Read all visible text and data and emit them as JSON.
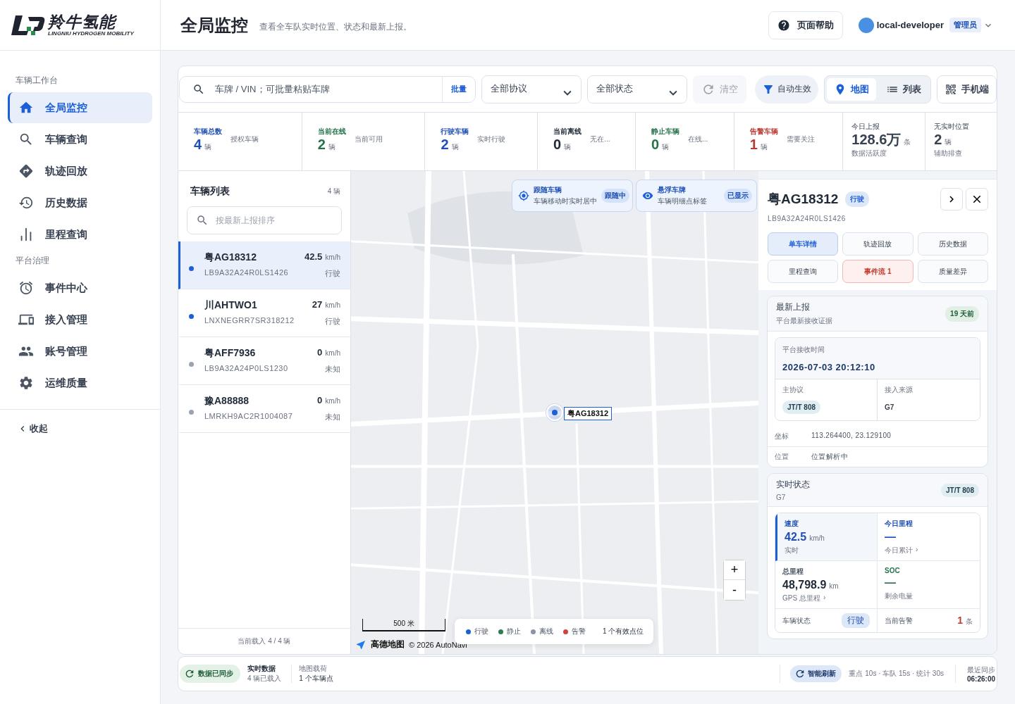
{
  "sidebar": {
    "logo": {
      "name": "羚牛氢能",
      "tagline": "LINGNIU HYDROGEN MOBILITY"
    },
    "sections": [
      {
        "title": "车辆工作台",
        "items": [
          {
            "label": "全局监控",
            "selected": true
          },
          {
            "label": "车辆查询",
            "selected": false
          },
          {
            "label": "轨迹回放",
            "selected": false
          },
          {
            "label": "历史数据",
            "selected": false
          },
          {
            "label": "里程查询",
            "selected": false
          }
        ]
      },
      {
        "title": "平台治理",
        "items": [
          {
            "label": "事件中心",
            "selected": false
          },
          {
            "label": "接入管理",
            "selected": false
          },
          {
            "label": "账号管理",
            "selected": false
          },
          {
            "label": "运维质量",
            "selected": false
          }
        ]
      }
    ],
    "collapse": "收起"
  },
  "header": {
    "title": "全局监控",
    "subtitle": "查看全车队实时位置、状态和最新上报。",
    "help": "页面帮助",
    "user": "local-developer",
    "role": "管理员"
  },
  "filters": {
    "search_placeholder": "车牌 / VIN；可批量粘贴车牌",
    "batch": "批量",
    "protocol": "全部协议",
    "status": "全部状态",
    "clear": "清空",
    "auto": "自动生效",
    "mobile": "手机端",
    "views": [
      {
        "label": "地图",
        "selected": true
      },
      {
        "label": "列表",
        "selected": false
      }
    ]
  },
  "stats": [
    {
      "kind": "inline",
      "label": "车辆总数",
      "value": "4",
      "unit": "辆",
      "note": "授权车辆",
      "color": "#1e4fb4"
    },
    {
      "kind": "inline",
      "label": "当前在线",
      "value": "2",
      "unit": "辆",
      "note": "当前可用",
      "color": "#24734a"
    },
    {
      "kind": "inline",
      "label": "行驶车辆",
      "value": "2",
      "unit": "辆",
      "note": "实时行驶",
      "color": "#1e4fb4"
    },
    {
      "kind": "inline",
      "label": "当前离线",
      "value": "0",
      "unit": "辆",
      "note": "无在...",
      "color": "#1f2937"
    },
    {
      "kind": "inline",
      "label": "静止车辆",
      "value": "0",
      "unit": "辆",
      "note": "在线...",
      "color": "#24734a"
    },
    {
      "kind": "inline",
      "label": "告警车辆",
      "value": "1",
      "unit": "辆",
      "note": "需要关注",
      "color": "#b83a32"
    },
    {
      "kind": "stacked",
      "label": "今日上报",
      "value": "128.6万",
      "unit": "条",
      "note": "数据活跃度",
      "color": "#374151"
    },
    {
      "kind": "stacked",
      "label": "无实时位置",
      "value": "2",
      "unit": "辆",
      "note": "辅助排查",
      "color": "#374151"
    }
  ],
  "vehicle_list": {
    "title": "车辆列表",
    "count": "4 辆",
    "placeholder": "按最新上报排序",
    "footer": "当前载入 4 / 4 辆",
    "vehicles": [
      {
        "plate": "粤AG18312",
        "vin": "LB9A32A24R0LS1426",
        "speed": "42.5",
        "unit": "km/h",
        "status": "行驶",
        "color": "#1d5fd6",
        "selected": true
      },
      {
        "plate": "川AHTWO1",
        "vin": "LNXNEGRR7SR318212",
        "speed": "27",
        "unit": "km/h",
        "status": "行驶",
        "color": "#1d5fd6",
        "selected": false
      },
      {
        "plate": "粤AFF7936",
        "vin": "LB9A32A24P0LS1230",
        "speed": "0",
        "unit": "km/h",
        "status": "未知",
        "color": "#9aa3b2",
        "selected": false
      },
      {
        "plate": "豫A88888",
        "vin": "LMRKH9AC2R1004087",
        "speed": "0",
        "unit": "km/h",
        "status": "未知",
        "color": "#9aa3b2",
        "selected": false
      }
    ]
  },
  "map": {
    "cards": [
      {
        "title": "跟随车辆",
        "desc": "车辆移动时实时居中",
        "badge": "跟随中"
      },
      {
        "title": "悬浮车牌",
        "desc": "车辆明细点标签",
        "badge": "已显示"
      }
    ],
    "marker_label": "粤AG18312",
    "zoom_in": "+",
    "zoom_out": "-",
    "scale": "500 米",
    "brand": "高德地图",
    "copyright": "© 2026 AutoNavi",
    "legend": [
      {
        "label": "行驶",
        "color": "#1d5fd6"
      },
      {
        "label": "静止",
        "color": "#2e7d4f"
      },
      {
        "label": "离线",
        "color": "#8a94a6"
      },
      {
        "label": "告警",
        "color": "#d0433a"
      }
    ],
    "legend_note": "1 个有效点位"
  },
  "detail": {
    "plate": "粤AG18312",
    "status": "行驶",
    "vin": "LB9A32A24R0LS1426",
    "actions": [
      {
        "label": "单车详情",
        "kind": "normal",
        "selected": true
      },
      {
        "label": "轨迹回放",
        "kind": "normal",
        "selected": false
      },
      {
        "label": "历史数据",
        "kind": "normal",
        "selected": false
      },
      {
        "label": "里程查询",
        "kind": "normal",
        "selected": false
      },
      {
        "label": "事件流 1",
        "kind": "alert",
        "selected": false
      },
      {
        "label": "质量差异",
        "kind": "normal",
        "selected": false
      }
    ],
    "latest": {
      "title": "最新上报",
      "subtitle": "平台最新接收证据",
      "badge": "19 天前",
      "time_label": "平台接收时间",
      "time": "2026-07-03 20:12:10",
      "protocol_label": "主协议",
      "protocol": "JT/T 808",
      "source_label": "接入来源",
      "source": "G7",
      "rows": [
        {
          "label": "坐标",
          "value": "113.264400, 23.129100"
        },
        {
          "label": "位置",
          "value": "位置解析中"
        }
      ]
    },
    "realtime": {
      "title": "实时状态",
      "subtitle": "G7",
      "badge": "JT/T 808",
      "metrics": [
        {
          "label": "速度",
          "value": "42.5",
          "unit": "km/h",
          "note": "实时",
          "selected": true,
          "color": "#1e4fb4"
        },
        {
          "label": "今日里程",
          "value": "—",
          "note": "今日累计",
          "chevron": "›",
          "selected": false,
          "color": "#1e4fb4"
        },
        {
          "label": "总里程",
          "value": "48,798.9",
          "unit": "km",
          "note": "GPS 总里程",
          "chevron": "›",
          "selected": false,
          "color": "#4b5563"
        },
        {
          "label": "SOC",
          "value": "—",
          "note": "剩余电量",
          "selected": false,
          "color": "#24734a"
        }
      ],
      "status_label": "车辆状态",
      "status": "行驶",
      "alarm_label": "当前告警",
      "alarm_count": "1",
      "alarm_unit": "条"
    }
  },
  "footer": {
    "sync": "数据已同步",
    "realtime_title": "实时数据",
    "realtime_sub": "4 辆已载入",
    "map_title": "地图载荷",
    "map_sub": "1 个车辆点",
    "refresh": "智能刷新",
    "intervals": "重点 10s · 车队 15s · 统计 30s",
    "last_sync_label": "最近同步",
    "last_sync": "06:26:00"
  }
}
